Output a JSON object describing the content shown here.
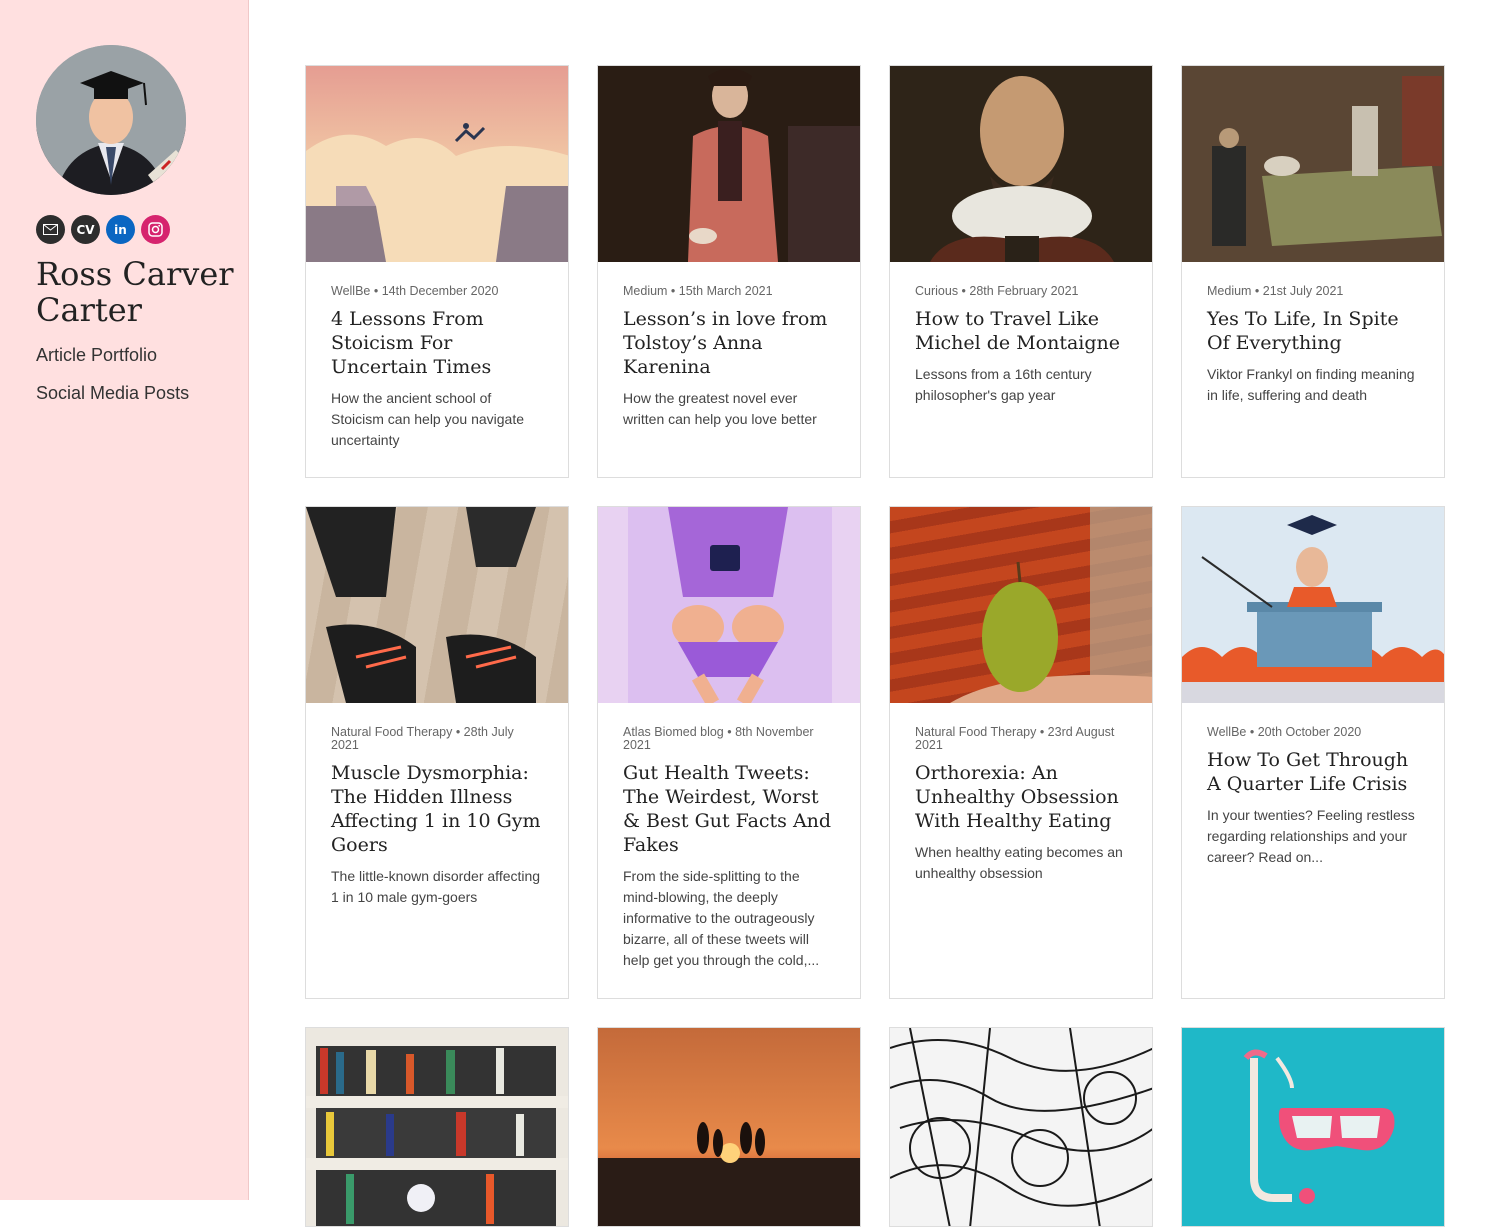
{
  "profile": {
    "name": "Ross Carver Carter",
    "socials": [
      {
        "icon": "mail-icon",
        "label": ""
      },
      {
        "icon": "cv-icon",
        "label": "CV"
      },
      {
        "icon": "linkedin-icon",
        "label": "in"
      },
      {
        "icon": "instagram-icon",
        "label": ""
      }
    ]
  },
  "nav": {
    "items": [
      {
        "label": "Article Portfolio"
      },
      {
        "label": "Social Media Posts"
      }
    ]
  },
  "colors": {
    "sidebar_bg": "#ffe0e0",
    "linkedin": "#0a66c2",
    "instagram": "#d6246e"
  },
  "cards": [
    {
      "meta": "WellBe • 14th December 2020",
      "title": "4 Lessons From Stoicism For Uncertain Times",
      "desc": "How the ancient school of Stoicism can help you navigate uncertainty"
    },
    {
      "meta": "Medium • 15th March 2021",
      "title": "Lesson’s in love from Tolstoy’s Anna Karenina",
      "desc": "How the greatest novel ever written can help you love better"
    },
    {
      "meta": "Curious • 28th February 2021",
      "title": "How to Travel Like Michel de Montaigne",
      "desc": "Lessons from a 16th century philosopher's gap year"
    },
    {
      "meta": "Medium • 21st July 2021",
      "title": "Yes To Life, In Spite Of Everything",
      "desc": "Viktor Frankyl on finding meaning in life, suffering and death"
    },
    {
      "meta": "Natural Food Therapy • 28th July 2021",
      "title": "Muscle Dysmorphia: The Hidden Illness Affecting 1 in 10 Gym Goers",
      "desc": "The little-known disorder affecting 1 in 10 male gym-goers"
    },
    {
      "meta": "Atlas Biomed blog • 8th November 2021",
      "title": "Gut Health Tweets: The Weirdest, Worst & Best Gut Facts And Fakes",
      "desc": "From the side-splitting to the mind-blowing, the deeply informative to the outrageously bizarre, all of these tweets will help get you through the cold,..."
    },
    {
      "meta": "Natural Food Therapy • 23rd August 2021",
      "title": "Orthorexia: An Unhealthy Obsession With Healthy Eating",
      "desc": "When healthy eating becomes an unhealthy obsession"
    },
    {
      "meta": "WellBe • 20th October 2020",
      "title": "How To Get Through A Quarter Life Crisis",
      "desc": "In your twenties? Feeling restless regarding relationships and your career? Read on..."
    }
  ]
}
